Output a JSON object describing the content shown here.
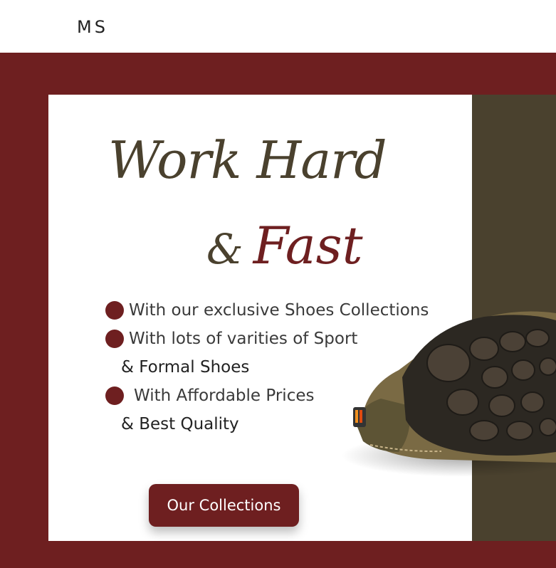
{
  "header": {
    "logo": "MS"
  },
  "hero": {
    "title_line1": "Work Hard",
    "title_amp": "&",
    "title_line2": "Fast",
    "features": [
      {
        "text": "With our exclusive Shoes Collections",
        "continuation": ""
      },
      {
        "text": "With lots of varities of Sport",
        "continuation": "& Formal Shoes"
      },
      {
        "text": "With Affordable Prices",
        "continuation": "& Best Quality"
      }
    ],
    "cta_label": "Our Collections"
  },
  "colors": {
    "brand_maroon": "#6e1f20",
    "olive_dark": "#4a412e",
    "card_bg": "#ffffff"
  },
  "icons": {
    "bullet": "bullet-dot-icon",
    "product": "shoe-image"
  }
}
